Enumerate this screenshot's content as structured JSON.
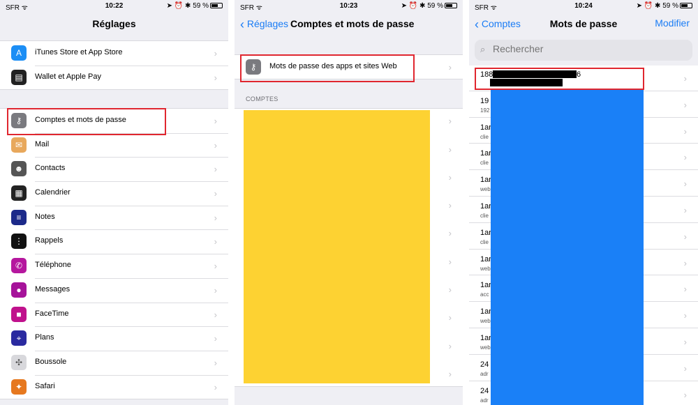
{
  "status": {
    "carrier": "SFR",
    "times": [
      "10:22",
      "10:23",
      "10:24"
    ],
    "battery": "59 %"
  },
  "screen1": {
    "title": "Réglages",
    "group1": [
      {
        "label": "iTunes Store et App Store",
        "icon": "app-store-icon",
        "color": "#1c8ef5"
      },
      {
        "label": "Wallet et Apple Pay",
        "icon": "wallet-icon",
        "color": "#222222"
      }
    ],
    "group2": [
      {
        "label": "Comptes et mots de passe",
        "icon": "key-icon",
        "color": "#7a7a7f"
      },
      {
        "label": "Mail",
        "icon": "mail-icon",
        "color": "#2a8cf7"
      },
      {
        "label": "Contacts",
        "icon": "contacts-icon",
        "color": "#8d8d92"
      },
      {
        "label": "Calendrier",
        "icon": "calendar-icon",
        "color": "#ffffff"
      },
      {
        "label": "Notes",
        "icon": "notes-icon",
        "color": "#f7cf3a"
      },
      {
        "label": "Rappels",
        "icon": "reminders-icon",
        "color": "#ffffff"
      },
      {
        "label": "Téléphone",
        "icon": "phone-icon",
        "color": "#35c759"
      },
      {
        "label": "Messages",
        "icon": "messages-icon",
        "color": "#35c759"
      },
      {
        "label": "FaceTime",
        "icon": "facetime-icon",
        "color": "#35c759"
      },
      {
        "label": "Plans",
        "icon": "maps-icon",
        "color": "#5fb85a"
      },
      {
        "label": "Boussole",
        "icon": "compass-icon",
        "color": "#222222"
      },
      {
        "label": "Safari",
        "icon": "safari-icon",
        "color": "#1c8ef5"
      }
    ]
  },
  "screen2": {
    "back": "Réglages",
    "title": "Comptes et mots de passe",
    "passwords_row": "Mots de passe des apps et sites Web",
    "section": "COMPTES",
    "redaction_color": "#fdd232"
  },
  "screen3": {
    "back": "Comptes",
    "title": "Mots de passe",
    "edit": "Modifier",
    "search_placeholder": "Rechercher",
    "redaction_color": "#1a80f7",
    "rows": [
      {
        "t1": "188",
        "t1b": "6",
        "t2": ""
      },
      {
        "t1": "19",
        "t2": "192"
      },
      {
        "t1": "1ar",
        "t2": "clie"
      },
      {
        "t1": "1ar",
        "t2": "clie"
      },
      {
        "t1": "1ar",
        "t2": "web"
      },
      {
        "t1": "1ar",
        "t2": "clie"
      },
      {
        "t1": "1ar",
        "t2": "clie"
      },
      {
        "t1": "1ar",
        "t2": "web"
      },
      {
        "t1": "1ar",
        "t2": "acc"
      },
      {
        "t1": "1ar",
        "t2": "web"
      },
      {
        "t1": "1ar",
        "t2": "web"
      },
      {
        "t1": "24",
        "t2": "adr"
      },
      {
        "t1": "24",
        "t2": "adr"
      }
    ]
  }
}
